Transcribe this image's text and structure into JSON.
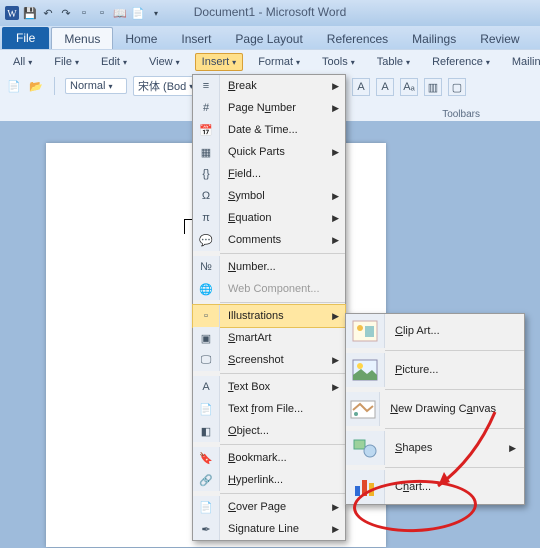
{
  "title": "Document1 - Microsoft Word",
  "tabs": {
    "file": "File",
    "menus": "Menus",
    "home": "Home",
    "insert": "Insert",
    "pagelayout": "Page Layout",
    "references": "References",
    "mailings": "Mailings",
    "review": "Review"
  },
  "rb": {
    "all": "All",
    "file": "File",
    "edit": "Edit",
    "view": "View",
    "insert": "Insert",
    "format": "Format",
    "tools": "Tools",
    "table": "Table",
    "reference": "Reference",
    "mailing": "Mailing"
  },
  "rb2": {
    "style": "Normal",
    "font": "宋体 (Bod"
  },
  "toolbars": "Toolbars",
  "menu": [
    {
      "k": "break",
      "label": "Break",
      "u": "B",
      "arr": true
    },
    {
      "k": "pagenum",
      "label": "Page Number",
      "u": "",
      "arr": true,
      "underline": "u"
    },
    {
      "k": "datetime",
      "label": "Date & Time...",
      "u": ""
    },
    {
      "k": "quickparts",
      "label": "Quick Parts",
      "arr": true
    },
    {
      "k": "field",
      "label": "Field...",
      "underline": "F"
    },
    {
      "k": "symbol",
      "label": "Symbol",
      "underline": "S",
      "arr": true
    },
    {
      "k": "equation",
      "label": "Equation",
      "underline": "E",
      "arr": true
    },
    {
      "k": "comments",
      "label": "Comments",
      "underline": "",
      "arr": true
    },
    {
      "k": "number",
      "label": "Number...",
      "underline": "N"
    },
    {
      "k": "webcomp",
      "label": "Web Component...",
      "dis": true
    },
    {
      "k": "illust",
      "label": "Illustrations",
      "hi": true,
      "arr": true
    },
    {
      "k": "smartart",
      "label": "SmartArt",
      "underline": "S"
    },
    {
      "k": "screenshot",
      "label": "Screenshot",
      "underline": "S",
      "arr": true
    },
    {
      "k": "textbox",
      "label": "Text Box",
      "underline": "T",
      "arr": true
    },
    {
      "k": "textfromfile",
      "label": "Text from File...",
      "underline": "f"
    },
    {
      "k": "object",
      "label": "Object...",
      "underline": "O"
    },
    {
      "k": "bookmark",
      "label": "Bookmark...",
      "underline": "B"
    },
    {
      "k": "hyperlink",
      "label": "Hyperlink...",
      "underline": "H"
    },
    {
      "k": "coverpage",
      "label": "Cover Page",
      "underline": "C",
      "arr": true
    },
    {
      "k": "sigline",
      "label": "Signature Line",
      "underline": "",
      "arr": true
    }
  ],
  "submenu": {
    "clipart": "Clip Art...",
    "picture": "Picture...",
    "newcanvas": "New Drawing Canvas",
    "shapes": "Shapes",
    "chart": "Chart..."
  }
}
